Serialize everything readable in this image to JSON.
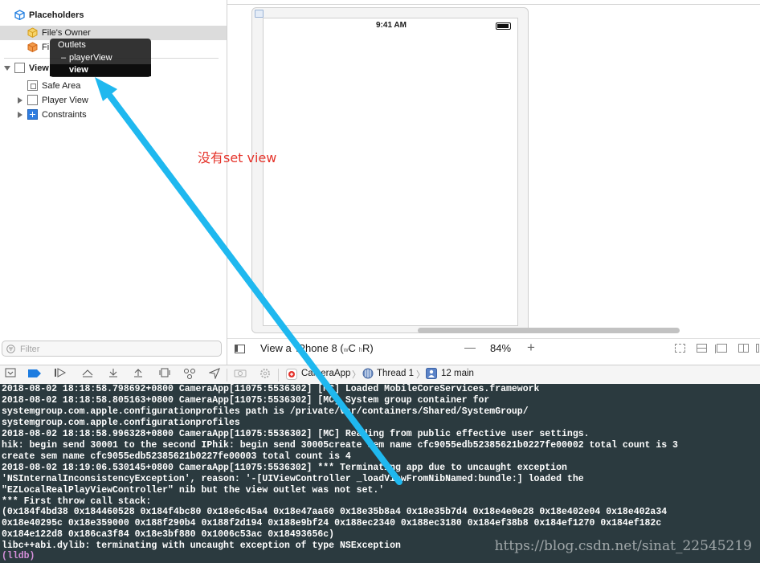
{
  "outline": {
    "placeholders_label": "Placeholders",
    "files_owner_label": "File's Owner",
    "first_responder_label": "Fi",
    "view_label": "View",
    "safe_area_label": "Safe Area",
    "player_view_label": "Player View",
    "constraints_label": "Constraints"
  },
  "outlets_popup": {
    "title": "Outlets",
    "items": [
      "playerView",
      "view"
    ],
    "item_prefix": "–"
  },
  "filter": {
    "placeholder": "Filter"
  },
  "device": {
    "status_time": "9:41 AM"
  },
  "canvas_bar": {
    "view_as_prefix": "View a",
    "device_label": "iPhone 8 (",
    "size_class_w": "wC",
    "size_class_h": "hR",
    "close_paren": ")",
    "zoom_minus": "—",
    "zoom_level": "84%",
    "zoom_plus": "+"
  },
  "debug_bar": {
    "breadcrumb": [
      "CameraApp",
      "Thread 1",
      "12 main"
    ],
    "separator": "〉"
  },
  "console": {
    "lines": [
      "2018-08-02 18:18:58.798692+0800 CameraApp[11075:5536302] [MC] Loaded MobileCoreServices.framework",
      "2018-08-02 18:18:58.805163+0800 CameraApp[11075:5536302] [MC] System group container for",
      "systemgroup.com.apple.configurationprofiles path is /private/var/containers/Shared/SystemGroup/",
      "systemgroup.com.apple.configurationprofiles",
      "2018-08-02 18:18:58.996328+0800 CameraApp[11075:5536302] [MC] Reading from public effective user settings.",
      "hik: begin send 30001 to the second IPhik: begin send 30005create sem name cfc9055edb52385621b0227fe00002 total count is 3",
      "create sem name cfc9055edb52385621b0227fe00003 total count is 4",
      "2018-08-02 18:19:06.530145+0800 CameraApp[11075:5536302] *** Terminating app due to uncaught exception",
      "'NSInternalInconsistencyException', reason: '-[UIViewController _loadViewFromNibNamed:bundle:] loaded the",
      "\"EZLocalRealPlayViewController\" nib but the view outlet was not set.'",
      "*** First throw call stack:",
      "(0x184f4bd38 0x184460528 0x184f4bc80 0x18e6c45a4 0x18e47aa60 0x18e35b8a4 0x18e35b7d4 0x18e4e0e28 0x18e402e04 0x18e402a34",
      "0x18e40295c 0x18e359000 0x188f290b4 0x188f2d194 0x188e9bf24 0x188ec2340 0x188ec3180 0x184ef38b8 0x184ef1270 0x184ef182c",
      "0x184e122d8 0x186ca3f84 0x18e3bf880 0x1006c53ac 0x18493656c)",
      "libc++abi.dylib: terminating with uncaught exception of type NSException"
    ],
    "prompt": "(lldb)",
    "watermark": "https://blog.csdn.net/sinat_22545219"
  },
  "annotation": {
    "text": "没有set view",
    "color": "#e5332a"
  },
  "colors": {
    "arrow": "#1fb8ef",
    "console_bg": "#2b3a3f",
    "lldb": "#d48fd9",
    "icon_blue": "#1d7ce0",
    "icon_yellow": "#f0c23c",
    "icon_orange": "#f08a2b"
  },
  "icons": [
    "cube-icon",
    "disclosure-triangle-icon",
    "view-icon",
    "safe-area-icon",
    "constraints-icon",
    "filter-icon",
    "breakpoint-icon",
    "continue-icon",
    "step-over-icon",
    "step-in-icon",
    "step-out-icon",
    "camera-icon",
    "thread-icon"
  ]
}
